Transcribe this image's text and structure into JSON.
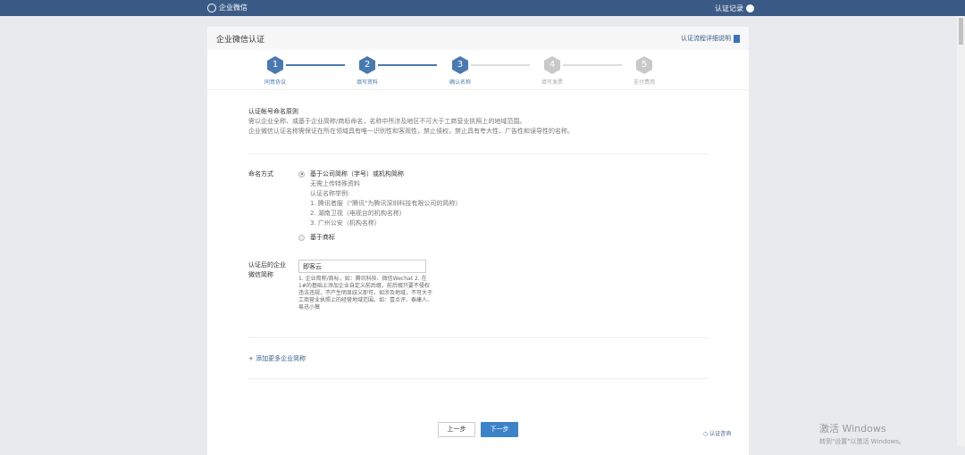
{
  "topbar": {
    "logo": "企业微信",
    "records": "认证记录"
  },
  "card": {
    "title": "企业微信认证",
    "flow_link": "认证流程详细说明"
  },
  "steps": [
    {
      "num": "1",
      "label": "同意协议",
      "state": "done"
    },
    {
      "num": "2",
      "label": "填写资料",
      "state": "done"
    },
    {
      "num": "3",
      "label": "确认名称",
      "state": "done"
    },
    {
      "num": "4",
      "label": "填写发票",
      "state": "todo"
    },
    {
      "num": "5",
      "label": "支付费用",
      "state": "todo"
    }
  ],
  "rules": {
    "title": "认证帐号命名原则",
    "line1": "需以企业全称、或基于企业简称/商标命名，名称中所涉及地区不可大于工商营业执照上的地域范围。",
    "line2": "企业微信认证名称需保证在所在领域具有唯一识别性和客观性，禁止侵权，禁止具有夸大性、广告性和误导性的名称。"
  },
  "naming": {
    "label": "命名方式",
    "option1": "基于公司简称（字号）或机构简称",
    "o1_desc": "无需上传特殊资料",
    "o1_examples_title": "认证名称举例:",
    "ex1": "1. 腾讯者服（\"腾讯\"为腾讯深圳科技有限公司的简称）",
    "ex2": "2. 湖南卫视（电视台的机构名称）",
    "ex3": "3. 广州公安（机构名称）",
    "option2": "基于商标"
  },
  "short_name": {
    "label1": "认证后的企业",
    "label2": "微信简称",
    "value": "即客云",
    "hint": "1. 企业简称/商标，如：腾讯科技、微信Wechat 2. 在1#的基础上添加企业自定义前后缀，前后缀只要不侵权违法违规，不产生明显歧义即可。如涉及地域，不可大于工商营业执照上的经营地域范围。如：壹点评、泰康人、易迅小薇"
  },
  "add_more": "+ 添加更多企业简称",
  "buttons": {
    "prev": "上一步",
    "next": "下一步"
  },
  "consult": "认证咨询",
  "watermark": {
    "title": "激活 Windows",
    "sub": "转到\"设置\"以激活 Windows。"
  }
}
